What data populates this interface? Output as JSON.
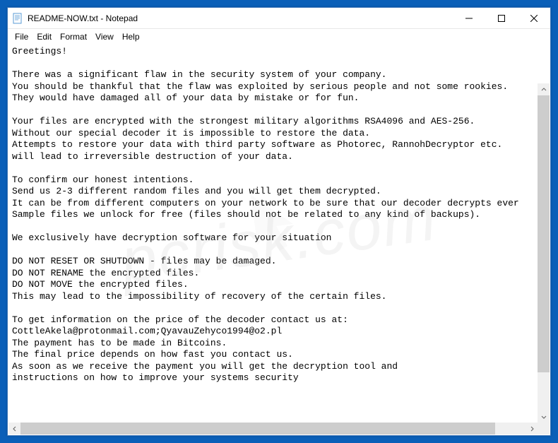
{
  "window": {
    "title": "README-NOW.txt - Notepad"
  },
  "menu": {
    "file": "File",
    "edit": "Edit",
    "format": "Format",
    "view": "View",
    "help": "Help"
  },
  "content": {
    "body": "Greetings!\n\nThere was a significant flaw in the security system of your company.\nYou should be thankful that the flaw was exploited by serious people and not some rookies.\nThey would have damaged all of your data by mistake or for fun.\n\nYour files are encrypted with the strongest military algorithms RSA4096 and AES-256.\nWithout our special decoder it is impossible to restore the data.\nAttempts to restore your data with third party software as Photorec, RannohDecryptor etc.\nwill lead to irreversible destruction of your data.\n\nTo confirm our honest intentions.\nSend us 2-3 different random files and you will get them decrypted.\nIt can be from different computers on your network to be sure that our decoder decrypts ever\nSample files we unlock for free (files should not be related to any kind of backups).\n\nWe exclusively have decryption software for your situation\n\nDO NOT RESET OR SHUTDOWN - files may be damaged.\nDO NOT RENAME the encrypted files.\nDO NOT MOVE the encrypted files.\nThis may lead to the impossibility of recovery of the certain files.\n\nTo get information on the price of the decoder contact us at:\nCottleAkela@protonmail.com;QyavauZehyco1994@o2.pl\nThe payment has to be made in Bitcoins.\nThe final price depends on how fast you contact us.\nAs soon as we receive the payment you will get the decryption tool and\ninstructions on how to improve your systems security"
  },
  "watermark": {
    "text": "pcrisk.com"
  }
}
